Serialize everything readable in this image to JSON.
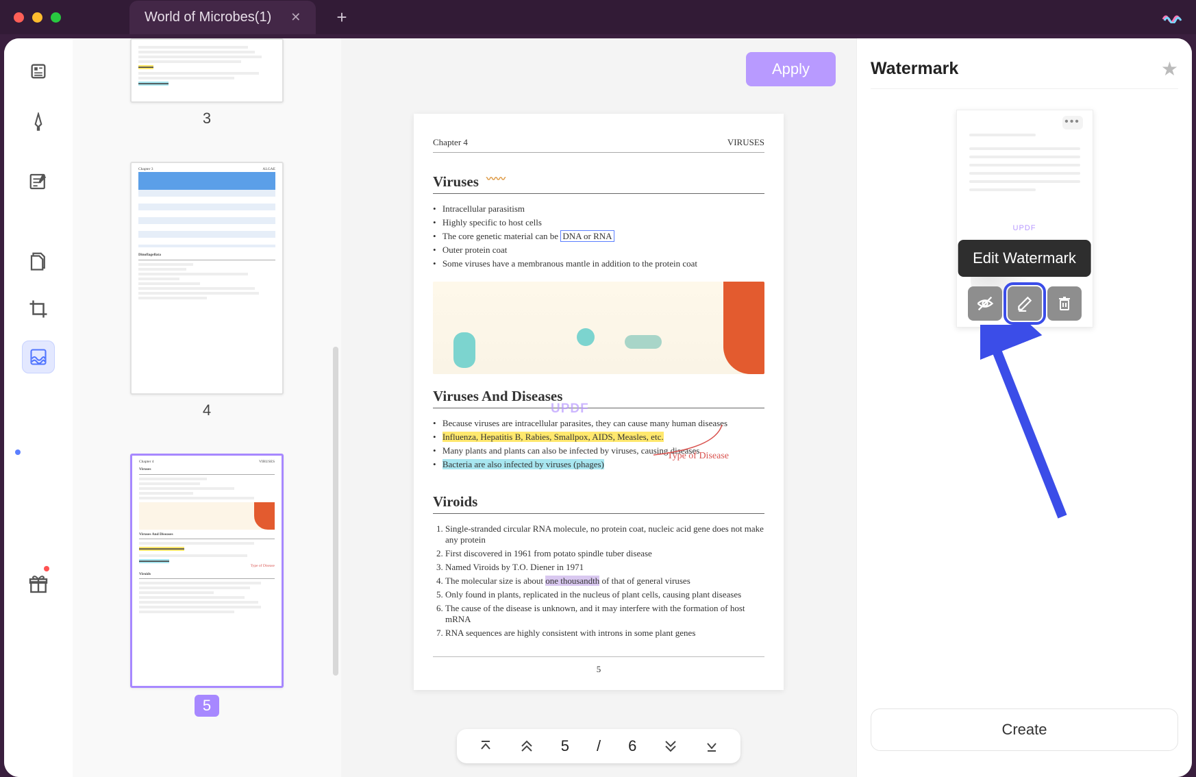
{
  "titlebar": {
    "tab_title": "World of Microbes(1)"
  },
  "apply_label": "Apply",
  "thumbnails": {
    "page3_num": "3",
    "page4_num": "4",
    "page5_num": "5",
    "page4_section": "Dinoflagellata"
  },
  "page_nav": {
    "current": "5",
    "separator": "/",
    "total": "6"
  },
  "document": {
    "chapter": "Chapter 4",
    "chapter_right": "VIRUSES",
    "h_viruses": "Viruses",
    "watermark_text": "UPDF",
    "bullets1": {
      "b1": "Intracellular parasitism",
      "b2": "Highly specific to host cells",
      "b3_pre": "The core genetic material can be ",
      "b3_box": "DNA or RNA",
      "b4": "Outer protein coat",
      "b5": "Some viruses have a membranous mantle in addition to the protein coat"
    },
    "h_diseases": "Viruses And Diseases",
    "bullets2": {
      "d1": "Because viruses are intracellular parasites, they can cause many human diseases",
      "d2": "Influenza, Hepatitis B, Rabies, Smallpox, AIDS, Measles, etc.",
      "d3": "Many plants and plants can also be infected by viruses, causing diseases",
      "d4": "Bacteria are also infected by viruses (phages)"
    },
    "annotation_type": "Type of Disease",
    "h_viroids": "Viroids",
    "olist": {
      "o1": "Single-stranded circular RNA molecule, no protein coat, nucleic acid gene does not make any protein",
      "o2": "First discovered in 1961 from potato spindle tuber disease",
      "o3": "Named Viroids by T.O. Diener in 1971",
      "o4_pre": "The molecular size is about ",
      "o4_hl": "one thousandth",
      "o4_post": " of that of general viruses",
      "o5": "Only found in plants, replicated in the nucleus of plant cells, causing plant diseases",
      "o6": "The cause of the disease is unknown, and it may interfere with the formation of host mRNA",
      "o7": "RNA sequences are highly consistent with introns in some plant genes"
    },
    "pagenum": "5"
  },
  "right_panel": {
    "title": "Watermark",
    "preview_label": "UPDF",
    "tooltip": "Edit Watermark",
    "create_label": "Create"
  }
}
